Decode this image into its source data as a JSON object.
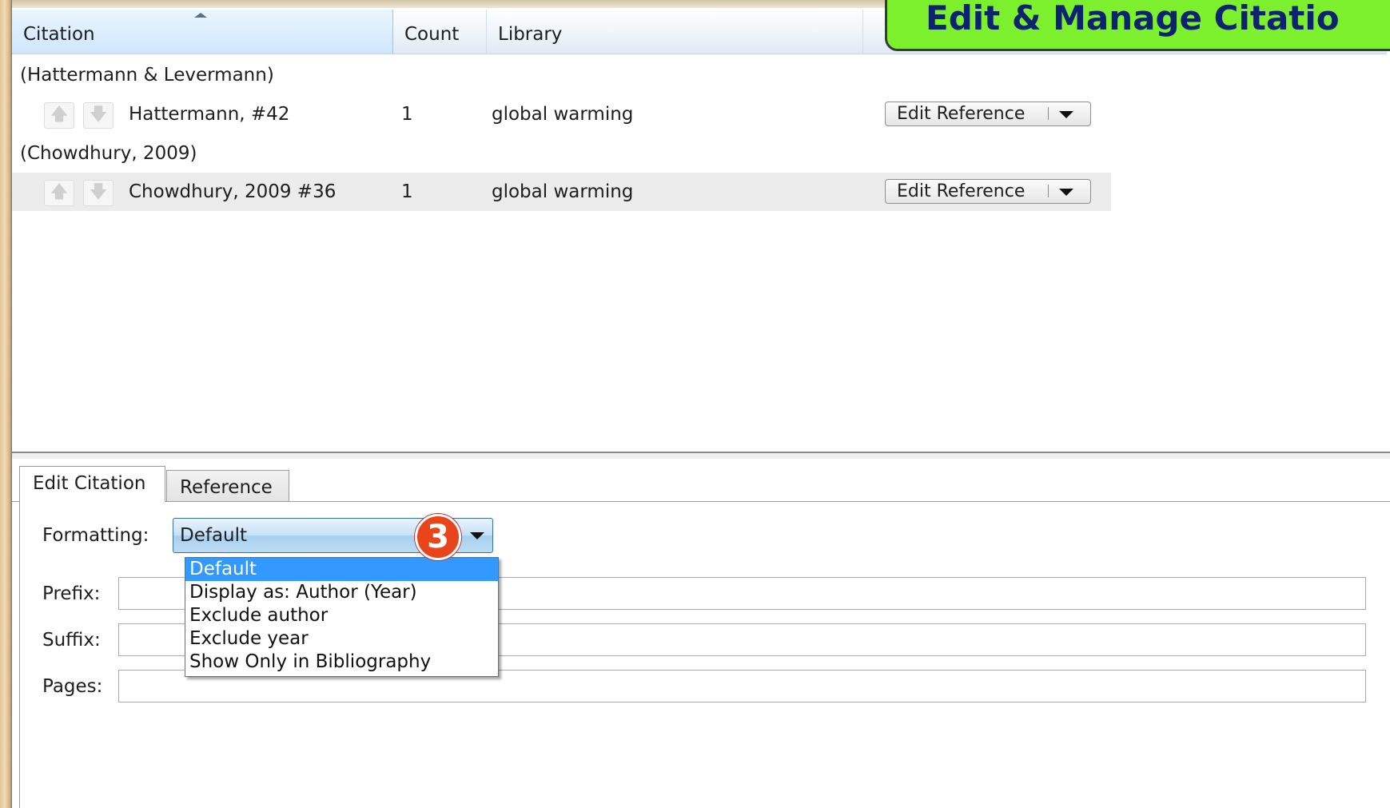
{
  "callout": {
    "title": "Edit & Manage Citatio",
    "color": "#7df02d"
  },
  "header": {
    "citation": "Citation",
    "count": "Count",
    "library": "Library"
  },
  "groups": [
    {
      "label": "(Hattermann & Levermann)",
      "reference": {
        "name": "Hattermann,  #42",
        "count": "1",
        "library": "global warming",
        "button": "Edit Reference"
      }
    },
    {
      "label": "(Chowdhury, 2009)",
      "reference": {
        "name": "Chowdhury, 2009 #36",
        "count": "1",
        "library": "global warming",
        "button": "Edit Reference"
      }
    }
  ],
  "tabs": {
    "edit_citation": "Edit Citation",
    "reference": "Reference"
  },
  "form": {
    "formatting_label": "Formatting:",
    "formatting_value": "Default",
    "prefix_label": "Prefix:",
    "prefix_value": "",
    "suffix_label": "Suffix:",
    "suffix_value": "",
    "pages_label": "Pages:",
    "pages_value": ""
  },
  "dropdown_options": [
    "Default",
    "Display as: Author (Year)",
    "Exclude author",
    "Exclude year",
    "Show Only in Bibliography"
  ],
  "step_badge": "3",
  "colors": {
    "selection": "#3399ff",
    "badge": "#e8461a"
  }
}
